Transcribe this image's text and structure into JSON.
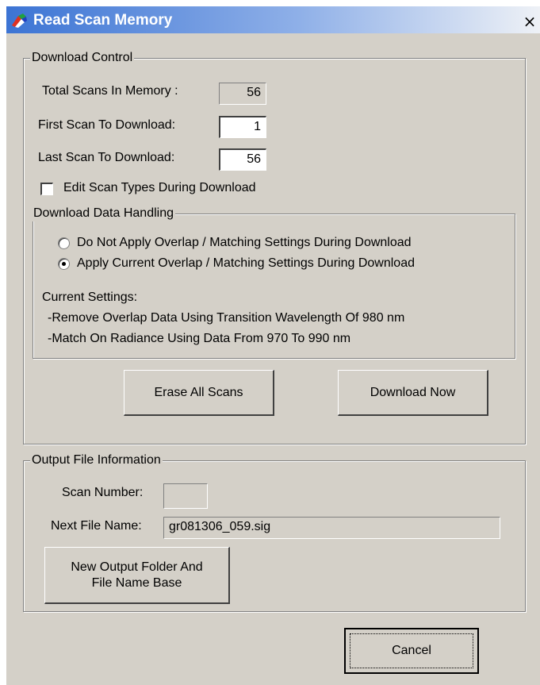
{
  "window": {
    "title": "Read Scan Memory",
    "close_glyph": "×",
    "icon": "app-logo-icon",
    "title_bar_color": "#3c74d4",
    "face_color": "#d4d0c8"
  },
  "download_control": {
    "legend": "Download Control",
    "total_scans_label": "Total Scans In Memory :",
    "total_scans_value": "56",
    "first_scan_label": "First Scan To Download:",
    "first_scan_value": "1",
    "last_scan_label": "Last Scan To Download:",
    "last_scan_value": "56",
    "edit_scan_types_label": "Edit Scan Types During Download",
    "edit_scan_types_checked": false,
    "data_handling": {
      "legend": "Download Data Handling",
      "option_no_apply": "Do Not Apply Overlap / Matching Settings During Download",
      "option_apply": "Apply Current Overlap / Matching Settings During Download",
      "selected": "apply",
      "current_settings_heading": "Current Settings:",
      "setting_line_1": "-Remove Overlap Data Using Transition Wavelength Of 980 nm",
      "setting_line_2": "-Match On Radiance Using Data From 970 To 990 nm"
    },
    "erase_button": "Erase All Scans",
    "download_button": "Download Now"
  },
  "output_file": {
    "legend": "Output File Information",
    "scan_number_label": "Scan Number:",
    "scan_number_value": "",
    "next_file_label": "Next File Name:",
    "next_file_value": "gr081306_059.sig",
    "new_folder_button": "New Output Folder And\nFile Name Base"
  },
  "cancel_button": "Cancel"
}
